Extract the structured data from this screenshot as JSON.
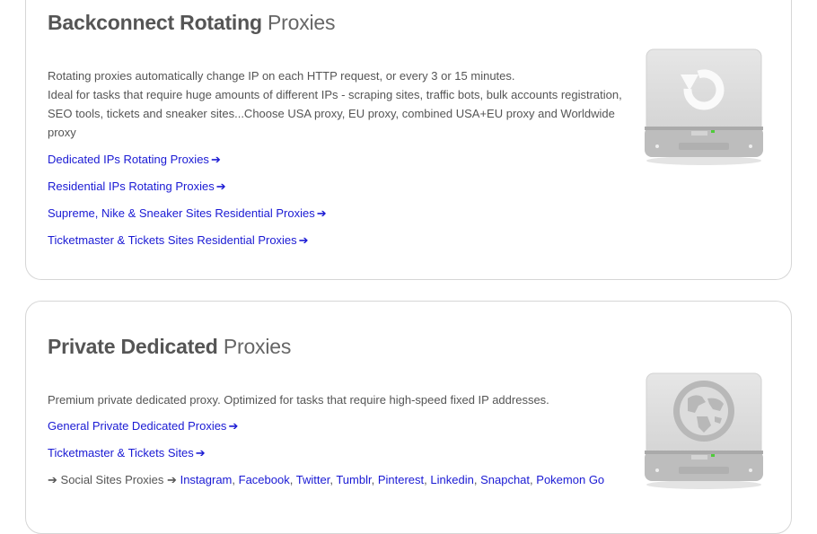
{
  "card1": {
    "title_bold": "Backconnect Rotating",
    "title_light": "Proxies",
    "description": [
      "Rotating proxies automatically change IP on each HTTP request, or every 3 or 15 minutes.",
      "Ideal for tasks that require huge amounts of different IPs - scraping sites, traffic bots, bulk accounts registration,",
      "SEO tools, tickets and sneaker sites...Choose USA proxy, EU proxy, combined USA+EU proxy and Worldwide proxy"
    ],
    "links": [
      "Dedicated IPs Rotating Proxies",
      "Residential IPs Rotating Proxies",
      "Supreme, Nike & Sneaker Sites Residential Proxies",
      "Ticketmaster & Tickets Sites Residential Proxies"
    ],
    "icon": "rotate-drive-icon"
  },
  "card2": {
    "title_bold": "Private Dedicated",
    "title_light": "Proxies",
    "description": "Premium private dedicated proxy. Optimized for tasks that require high-speed fixed IP addresses.",
    "links": [
      "General Private Dedicated Proxies",
      "Ticketmaster & Tickets Sites"
    ],
    "social_label": "Social Sites Proxies",
    "social_links": [
      "Instagram",
      "Facebook",
      "Twitter",
      "Tumblr",
      "Pinterest",
      "Linkedin",
      "Snapchat",
      "Pokemon Go"
    ],
    "icon": "globe-drive-icon"
  },
  "arrow": "➔",
  "separator": ",",
  "colors": {
    "link": "#1a1ad4",
    "text": "#555555",
    "border": "#d6d6d6",
    "drive": "#c8c8c8"
  }
}
